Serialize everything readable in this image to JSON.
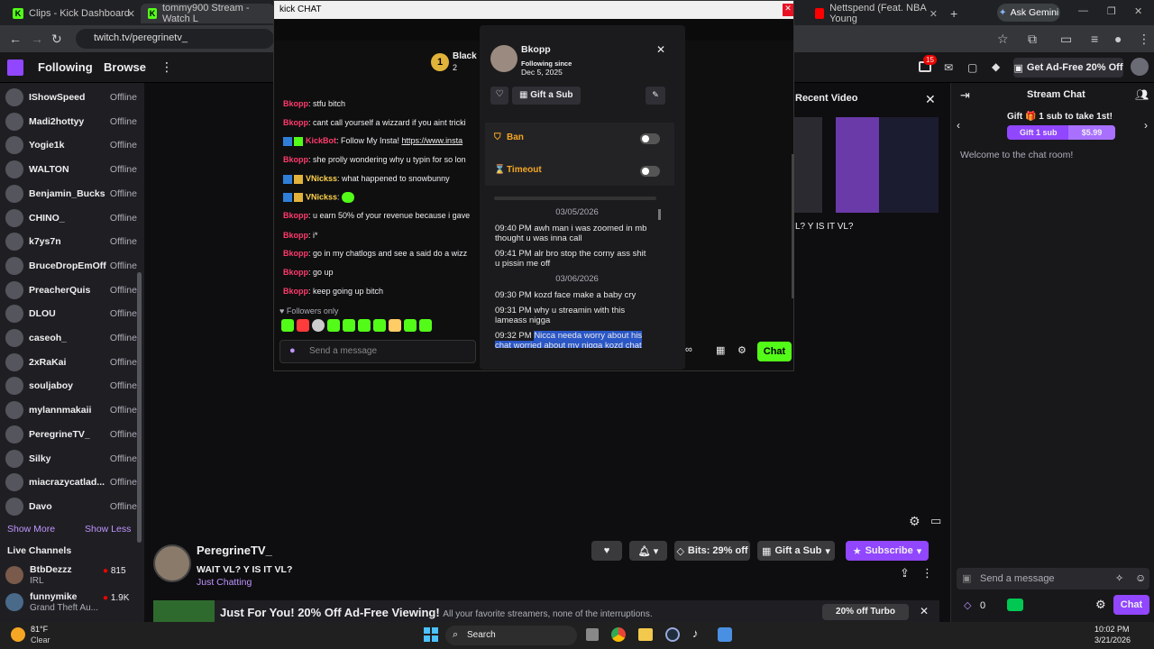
{
  "browser": {
    "tabs": [
      {
        "label": "Clips - Kick Dashboard",
        "icon": "kick-icon",
        "color": "#53fc18"
      },
      {
        "label": "tommy900 Stream - Watch L",
        "icon": "kick-icon",
        "color": "#53fc18"
      },
      {
        "label": "Nettspend (Feat. NBA Young",
        "icon": "youtube-icon",
        "color": "#ff0000"
      }
    ],
    "new_tab": "+",
    "gemini": "Ask Gemini",
    "url": "twitch.tv/peregrinetv_"
  },
  "topnav": {
    "following": "Following",
    "browse": "Browse",
    "more": "⋮",
    "notif_count": "15",
    "get_ad_free": "Get Ad-Free 20% Off"
  },
  "sidebar": {
    "channels": [
      {
        "name": "IShowSpeed",
        "status": "Offline"
      },
      {
        "name": "Madi2hottyy",
        "status": "Offline"
      },
      {
        "name": "Yogie1k",
        "status": "Offline"
      },
      {
        "name": "WALTON",
        "status": "Offline"
      },
      {
        "name": "Benjamin_Bucks",
        "status": "Offline"
      },
      {
        "name": "CHINO_",
        "status": "Offline"
      },
      {
        "name": "k7ys7n",
        "status": "Offline"
      },
      {
        "name": "BruceDropEmOff",
        "status": "Offline"
      },
      {
        "name": "PreacherQuis",
        "status": "Offline"
      },
      {
        "name": "DLOU",
        "status": "Offline"
      },
      {
        "name": "caseoh_",
        "status": "Offline"
      },
      {
        "name": "2xRaKai",
        "status": "Offline"
      },
      {
        "name": "souljaboy",
        "status": "Offline"
      },
      {
        "name": "mylannmakaii",
        "status": "Offline"
      },
      {
        "name": "PeregrineTV_",
        "status": "Offline"
      },
      {
        "name": "Silky",
        "status": "Offline"
      },
      {
        "name": "miacrazycatlad...",
        "status": "Offline"
      },
      {
        "name": "Davo",
        "status": "Offline"
      }
    ],
    "show_more": "Show More",
    "show_less": "Show Less",
    "live_heading": "Live Channels",
    "live": [
      {
        "name": "BtbDezzz",
        "category": "IRL",
        "viewers": "815"
      },
      {
        "name": "funnymike",
        "category": "Grand Theft Au...",
        "viewers": "1.9K"
      }
    ]
  },
  "popup": {
    "title": "kick CHAT",
    "header_name": "Black",
    "header_badge": "1",
    "header_sub": "2",
    "messages": [
      {
        "user": "Bkopp",
        "color": "#ff3b6b",
        "text": ": stfu bitch"
      },
      {
        "user": "Bkopp",
        "color": "#ff3b6b",
        "text": ": cant call yourself a wizzard if you aint tricki"
      },
      {
        "user": "KickBot",
        "color": "#ff3b6b",
        "text": ": Follow My Insta! ",
        "link": "https://www.insta"
      },
      {
        "user": "Bkopp",
        "color": "#ff3b6b",
        "text": ": she prolly wondering why u typin for so lon"
      },
      {
        "user": "VNickss",
        "color": "#ffd34d",
        "text": ": what happened to snowbunny"
      },
      {
        "user": "VNickss",
        "color": "#ffd34d",
        "text": ":"
      },
      {
        "user": "Bkopp",
        "color": "#ff3b6b",
        "text": ": u earn 50% of your revenue because i gave"
      },
      {
        "user": "Bkopp",
        "color": "#ff3b6b",
        "text": ": i*"
      },
      {
        "user": "Bkopp",
        "color": "#ff3b6b",
        "text": ": go in my chatlogs and see a said do a wizz"
      },
      {
        "user": "Bkopp",
        "color": "#ff3b6b",
        "text": ": go up"
      },
      {
        "user": "Bkopp",
        "color": "#ff3b6b",
        "text": ": keep going up bitch"
      }
    ],
    "followers_only": "Followers only",
    "input_placeholder": "Send a message",
    "chat_button": "Chat"
  },
  "usercard": {
    "username": "Bkopp",
    "following_since_label": "Following since",
    "following_since_date": "Dec 5, 2025",
    "gift_sub": "Gift a Sub",
    "ban": "Ban",
    "timeout": "Timeout",
    "history": [
      {
        "type": "date",
        "text": "03/05/2026"
      },
      {
        "type": "msg",
        "time": "09:40 PM",
        "text": "awh man i was zoomed in mb",
        "text2": "thought u was inna call"
      },
      {
        "type": "msg",
        "time": "09:41 PM",
        "text": "alr bro stop the corny ass shit",
        "text2": "u pissin me off"
      },
      {
        "type": "date",
        "text": "03/06/2026"
      },
      {
        "type": "msg",
        "time": "09:30 PM",
        "text": "kozd face make a baby cry"
      },
      {
        "type": "msg",
        "time": "09:31 PM",
        "text": "why u streamin with this",
        "text2": "lameass nigga"
      },
      {
        "type": "msg",
        "time": "09:32 PM",
        "text": "Nicca needa worry about his",
        "text2": "chat worried about my nigga kozd chat"
      }
    ]
  },
  "main": {
    "recent_video": "Recent Video",
    "video_title_snip": "L? Y IS IT VL?",
    "channel_name": "PeregrineTV_",
    "stream_title": "WAIT VL? Y IS IT VL?",
    "category": "Just Chatting",
    "bits": "Bits: 29% off",
    "gift_sub": "Gift a Sub",
    "subscribe": "Subscribe",
    "promo": "Just For You! 20% Off Ad-Free Viewing!",
    "promo_sub": "All your favorite streamers, none of the interruptions.",
    "turbo": "20% off Turbo"
  },
  "rchat": {
    "title": "Stream Chat",
    "gift_text": "Gift 🎁 1 sub to take 1st!",
    "gift_btn": "Gift 1 sub",
    "price": "$5.99",
    "welcome": "Welcome to the chat room!",
    "input_placeholder": "Send a message",
    "points": "0",
    "chat_button": "Chat"
  },
  "taskbar": {
    "temp": "81°F",
    "weather": "Clear",
    "search": "Search",
    "time": "10:02 PM",
    "date": "3/21/2026"
  }
}
